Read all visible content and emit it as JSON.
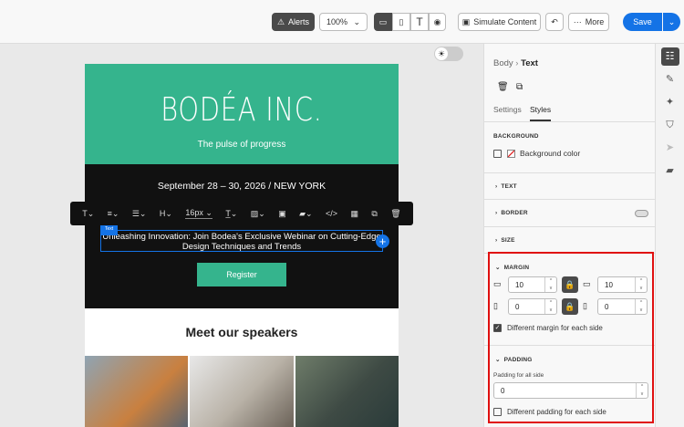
{
  "toolbar": {
    "alerts": "Alerts",
    "zoom": "100%",
    "simulate": "Simulate Content",
    "more": "More",
    "save": "Save"
  },
  "email": {
    "logo": "BODÉA INC.",
    "tagline": "The pulse of progress",
    "date": "September 28 – 30, 2026 / NEW YORK",
    "selected_tag": "Text",
    "headline": "Unleashing Innovation: Join Bodea's Exclusive Webinar on Cutting-Edge Design Techniques and Trends",
    "register": "Register",
    "speakers": "Meet our speakers"
  },
  "rte": {
    "font_size": "16px",
    "heading": "H"
  },
  "panel": {
    "breadcrumb_parent": "Body",
    "breadcrumb_current": "Text",
    "tabs": [
      "Settings",
      "Styles"
    ],
    "background_title": "BACKGROUND",
    "background_color": "Background color",
    "sections": [
      "TEXT",
      "BORDER",
      "SIZE"
    ],
    "margin_title": "MARGIN",
    "margin_top": "10",
    "margin_bottom": "10",
    "margin_left": "0",
    "margin_right": "0",
    "margin_diff": "Different margin for each side",
    "padding_title": "PADDING",
    "padding_label": "Padding for all side",
    "padding_value": "0",
    "padding_diff": "Different padding for each side"
  }
}
